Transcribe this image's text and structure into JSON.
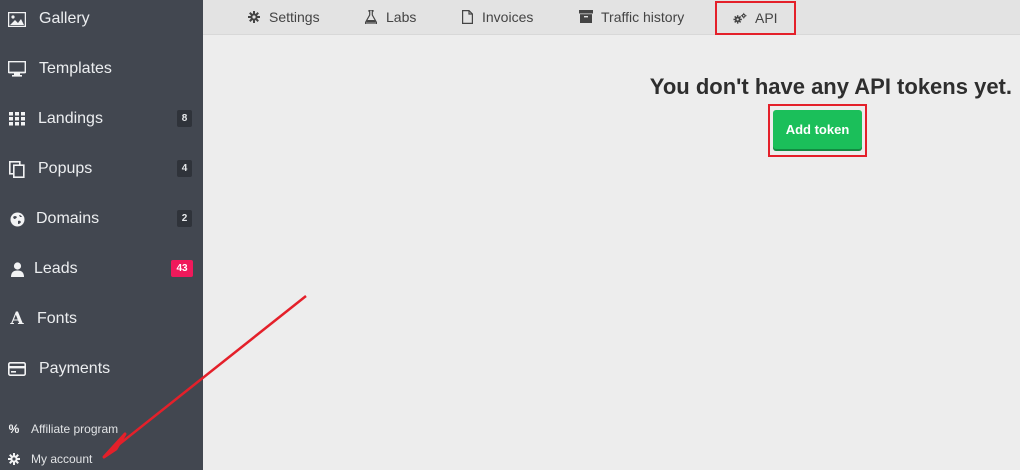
{
  "sidebar": {
    "items": [
      {
        "label": "Gallery",
        "icon": "image-icon",
        "badge": ""
      },
      {
        "label": "Templates",
        "icon": "monitor-icon",
        "badge": ""
      },
      {
        "label": "Landings",
        "icon": "grid-icon",
        "badge": "8"
      },
      {
        "label": "Popups",
        "icon": "copy-icon",
        "badge": "4"
      },
      {
        "label": "Domains",
        "icon": "globe-icon",
        "badge": "2"
      },
      {
        "label": "Leads",
        "icon": "user-icon",
        "badge": "43"
      },
      {
        "label": "Fonts",
        "icon": "font-icon",
        "badge": ""
      },
      {
        "label": "Payments",
        "icon": "credit-card-icon",
        "badge": ""
      }
    ],
    "sub_items": [
      {
        "label": "Affiliate program",
        "icon": "percent-icon"
      },
      {
        "label": "My account",
        "icon": "gear-icon"
      }
    ],
    "leads_badge_color": "#f0195b"
  },
  "tabs": [
    {
      "label": "Settings",
      "icon": "gear-icon"
    },
    {
      "label": "Labs",
      "icon": "flask-icon"
    },
    {
      "label": "Invoices",
      "icon": "file-icon"
    },
    {
      "label": "Traffic history",
      "icon": "archive-icon"
    },
    {
      "label": "API",
      "icon": "cogs-icon"
    }
  ],
  "main": {
    "empty_title": "You don't have any API tokens yet.",
    "add_button_label": "Add token",
    "accent_color": "#1bbf5a",
    "highlight_color": "#e4202a"
  }
}
